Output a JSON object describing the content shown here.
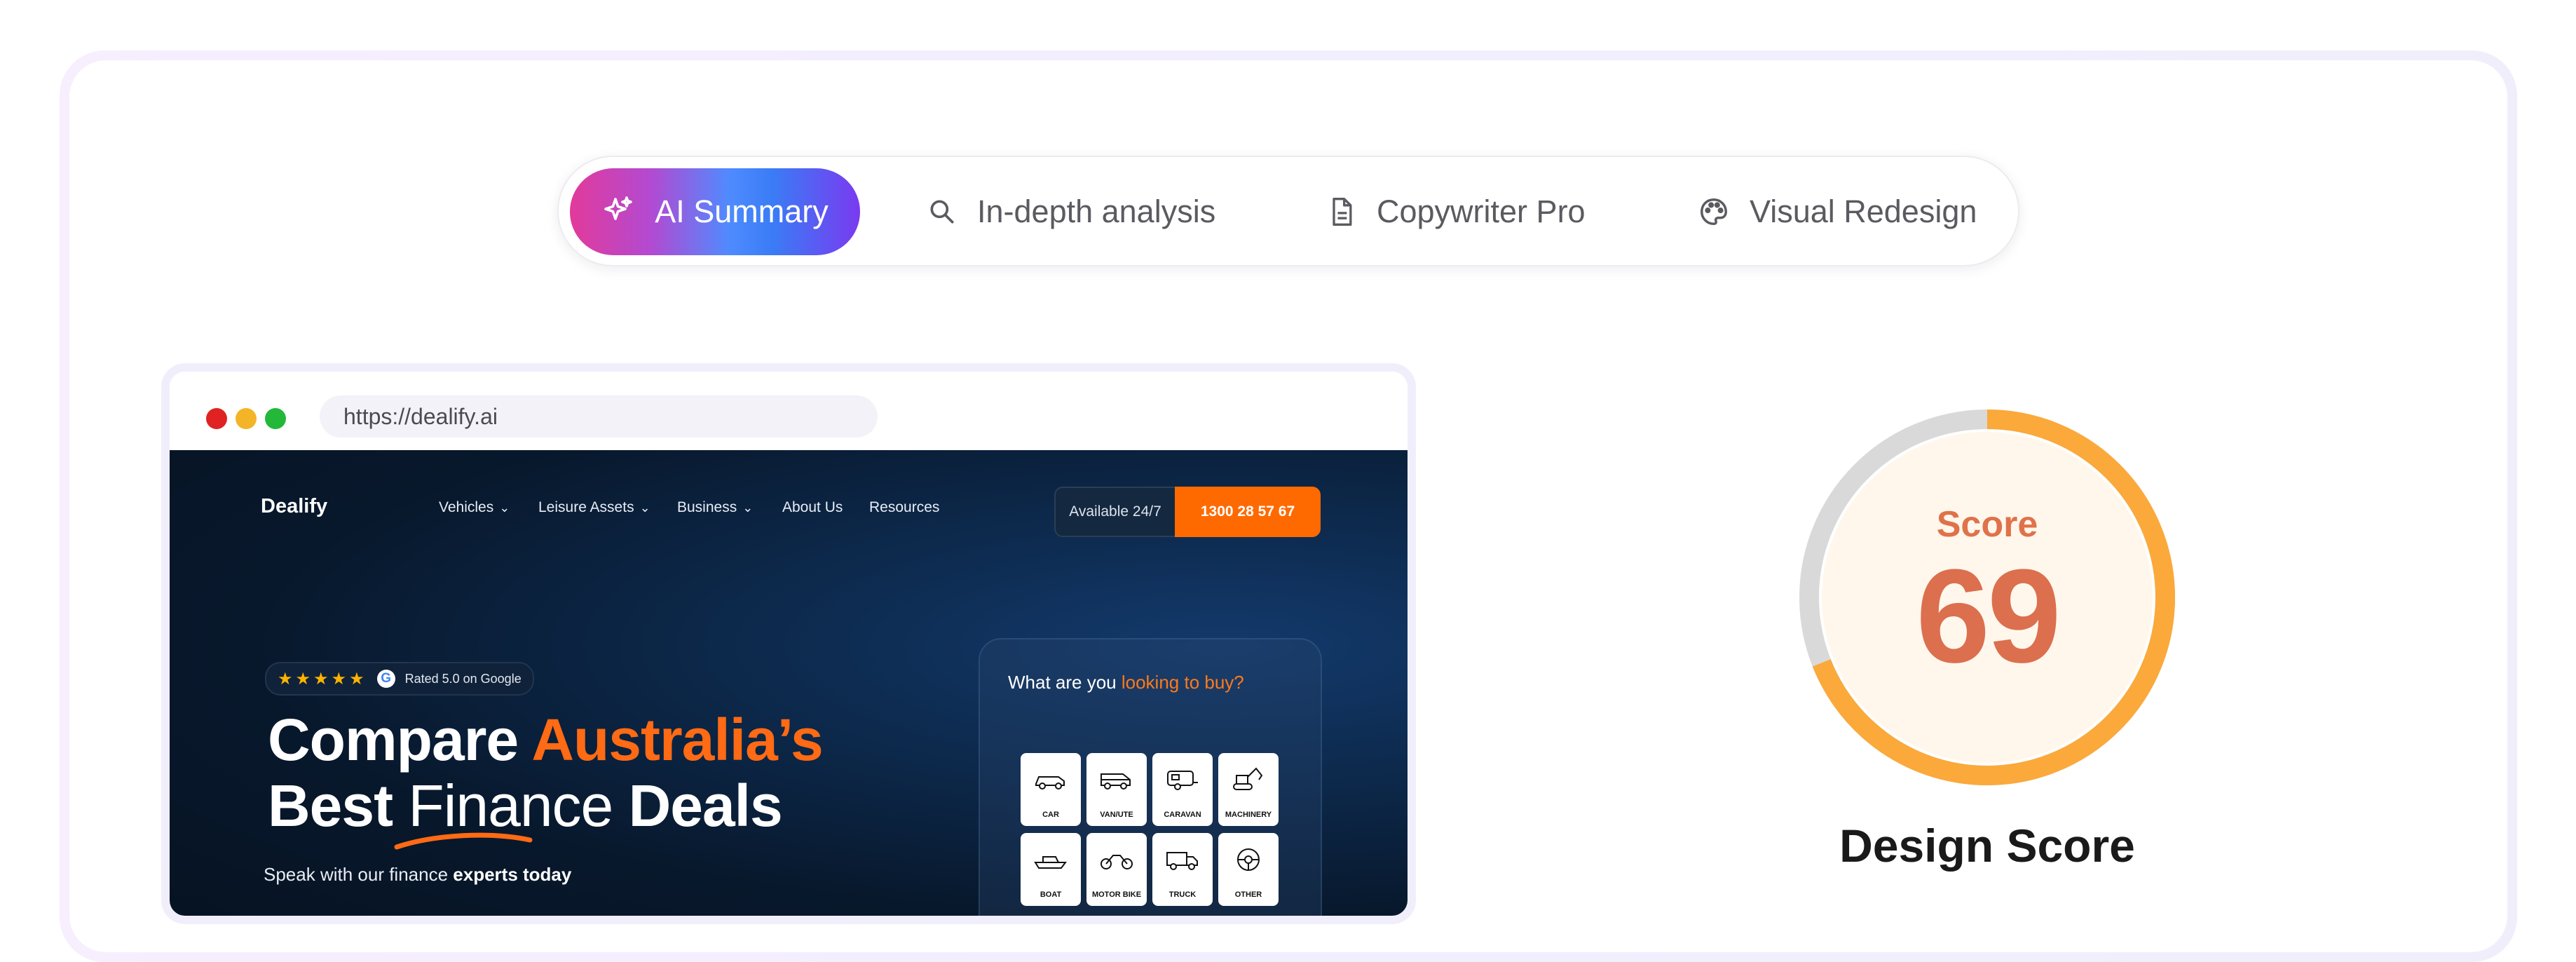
{
  "tabs": [
    {
      "label": "AI Summary",
      "icon": "sparkle-icon",
      "active": true
    },
    {
      "label": "In-depth analysis",
      "icon": "search-icon"
    },
    {
      "label": "Copywriter Pro",
      "icon": "document-icon"
    },
    {
      "label": "Visual Redesign",
      "icon": "palette-icon"
    }
  ],
  "browser": {
    "url": "https://dealify.ai",
    "window_buttons": [
      "close",
      "minimize",
      "maximize"
    ]
  },
  "site": {
    "logo": "Dealify",
    "nav": [
      {
        "label": "Vehicles",
        "dropdown": true
      },
      {
        "label": "Leisure Assets",
        "dropdown": true
      },
      {
        "label": "Business",
        "dropdown": true
      },
      {
        "label": "About Us",
        "dropdown": false
      },
      {
        "label": "Resources",
        "dropdown": false
      }
    ],
    "available": "Available 24/7",
    "phone": "1300 28 57 67",
    "rating_stars": "★★★★★",
    "rating_text": "Rated 5.0 on Google",
    "hero_line1_a": "Compare ",
    "hero_line1_b": "Australia’s",
    "hero_line2_a": "Best ",
    "hero_line2_b": "Finance",
    "hero_line2_c": " Deals",
    "subtext_a": "Speak with our finance ",
    "subtext_b": "experts today",
    "panel_question_a": "What are you ",
    "panel_question_b": "looking to buy?",
    "vehicles": [
      "CAR",
      "VAN/UTE",
      "CARAVAN",
      "MACHINERY",
      "BOAT",
      "MOTOR BIKE",
      "TRUCK",
      "OTHER"
    ]
  },
  "score": {
    "label": "Score",
    "value": "69",
    "fraction": 0.69,
    "caption": "Design Score",
    "accent_color": "#fba93a",
    "track_color": "#d9d9d9"
  }
}
